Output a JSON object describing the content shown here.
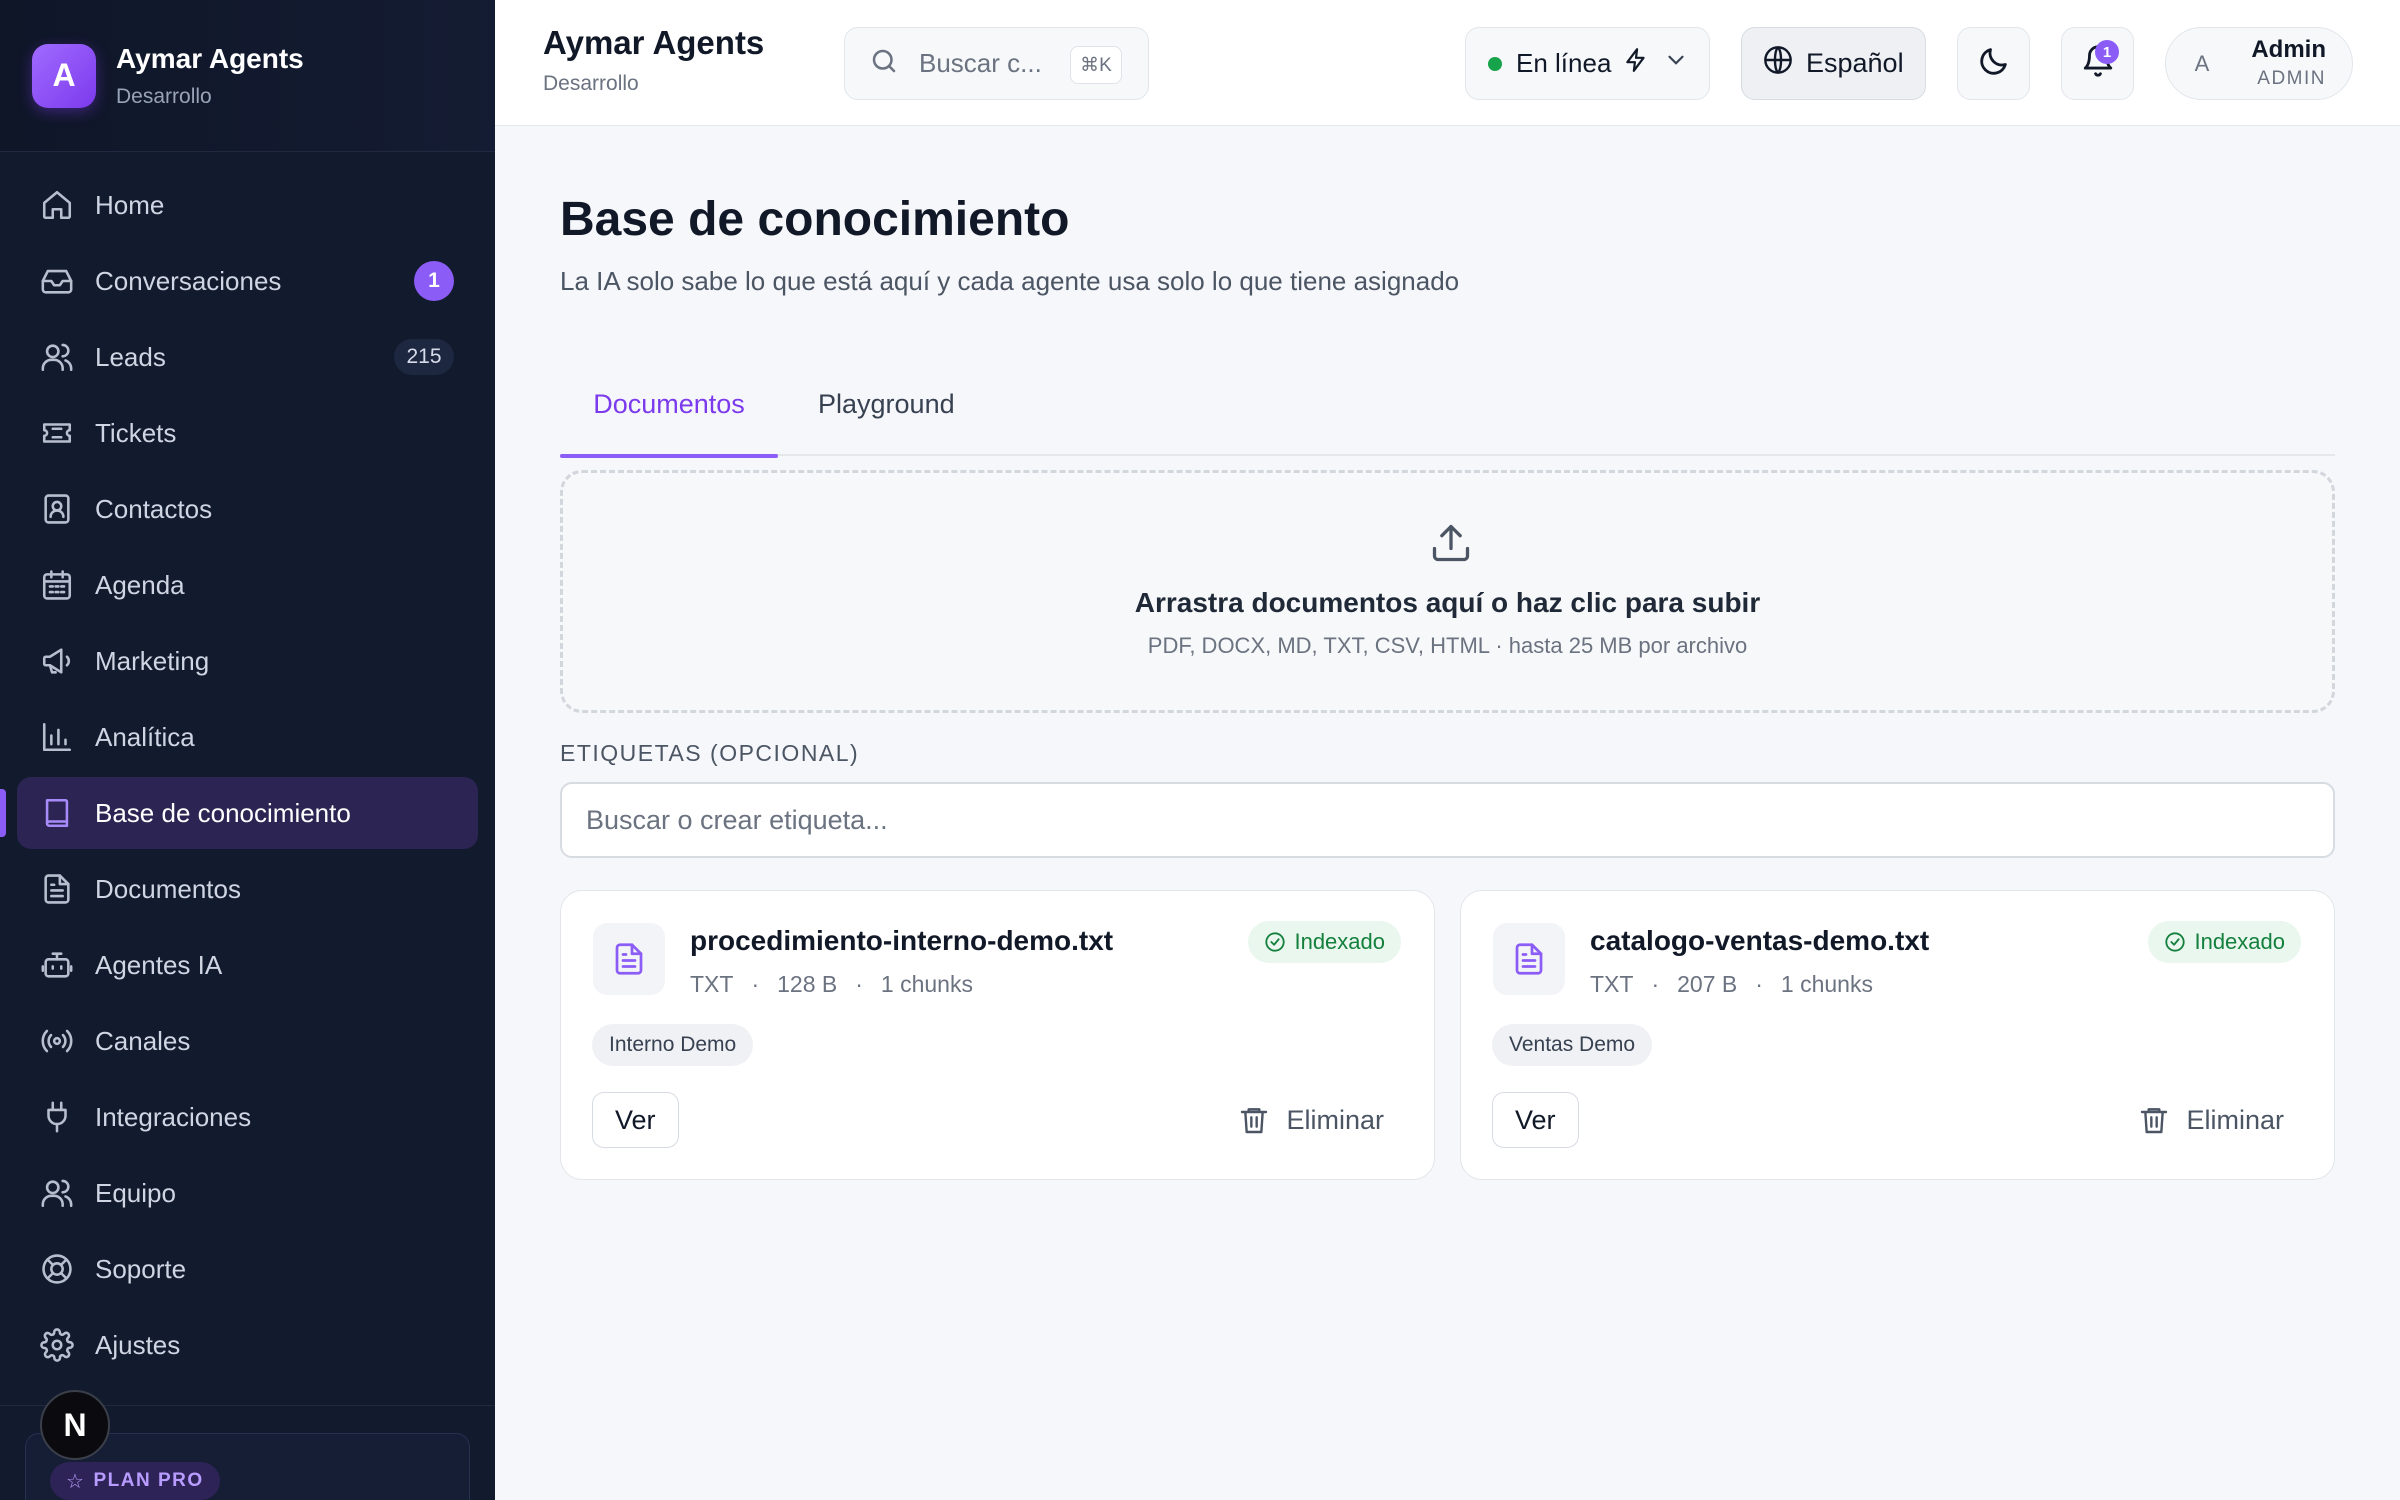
{
  "brand": {
    "logo_letter": "A",
    "name": "Aymar Agents",
    "env": "Desarrollo"
  },
  "sidebar": {
    "items": [
      {
        "label": "Home",
        "icon": "home-icon"
      },
      {
        "label": "Conversaciones",
        "icon": "inbox-icon",
        "badge": "1"
      },
      {
        "label": "Leads",
        "icon": "users-icon",
        "count": "215"
      },
      {
        "label": "Tickets",
        "icon": "ticket-icon"
      },
      {
        "label": "Contactos",
        "icon": "contact-book-icon"
      },
      {
        "label": "Agenda",
        "icon": "calendar-icon"
      },
      {
        "label": "Marketing",
        "icon": "megaphone-icon"
      },
      {
        "label": "Analítica",
        "icon": "bar-chart-icon"
      },
      {
        "label": "Base de conocimiento",
        "icon": "book-icon",
        "active": true
      },
      {
        "label": "Documentos",
        "icon": "document-icon"
      },
      {
        "label": "Agentes IA",
        "icon": "bot-icon"
      },
      {
        "label": "Canales",
        "icon": "broadcast-icon"
      },
      {
        "label": "Integraciones",
        "icon": "plug-icon"
      },
      {
        "label": "Equipo",
        "icon": "team-icon"
      },
      {
        "label": "Soporte",
        "icon": "lifebuoy-icon"
      },
      {
        "label": "Ajustes",
        "icon": "gear-icon"
      }
    ],
    "plan_label": "PLAN PRO",
    "n_badge": "N"
  },
  "header": {
    "title": "Aymar Agents",
    "subtitle": "Desarrollo",
    "search_placeholder": "Buscar c...",
    "search_shortcut": "⌘K",
    "status_label": "En línea",
    "language_label": "Español",
    "notifications_count": "1",
    "user_initial": "A",
    "user_name": "Admin",
    "user_role": "ADMIN"
  },
  "colors": {
    "accent": "#8b5cf6",
    "sidebar_bg": "#121a2e",
    "status_online": "#16a34a"
  },
  "main": {
    "title": "Base de conocimiento",
    "subtitle": "La IA solo sabe lo que está aquí y cada agente usa solo lo que tiene asignado",
    "tabs": [
      {
        "label": "Documentos",
        "active": true
      },
      {
        "label": "Playground"
      }
    ],
    "dropzone": {
      "title": "Arrastra documentos aquí o haz clic para subir",
      "hint": "PDF, DOCX, MD, TXT, CSV, HTML · hasta 25 MB por archivo"
    },
    "tags_label": "ETIQUETAS (OPCIONAL)",
    "tags_placeholder": "Buscar o crear etiqueta...",
    "documents": [
      {
        "name": "procedimiento-interno-demo.txt",
        "type": "TXT",
        "size": "128 B",
        "chunks": "1 chunks",
        "status": "Indexado",
        "tag": "Interno Demo",
        "view_label": "Ver",
        "delete_label": "Eliminar"
      },
      {
        "name": "catalogo-ventas-demo.txt",
        "type": "TXT",
        "size": "207 B",
        "chunks": "1 chunks",
        "status": "Indexado",
        "tag": "Ventas Demo",
        "view_label": "Ver",
        "delete_label": "Eliminar"
      }
    ]
  }
}
